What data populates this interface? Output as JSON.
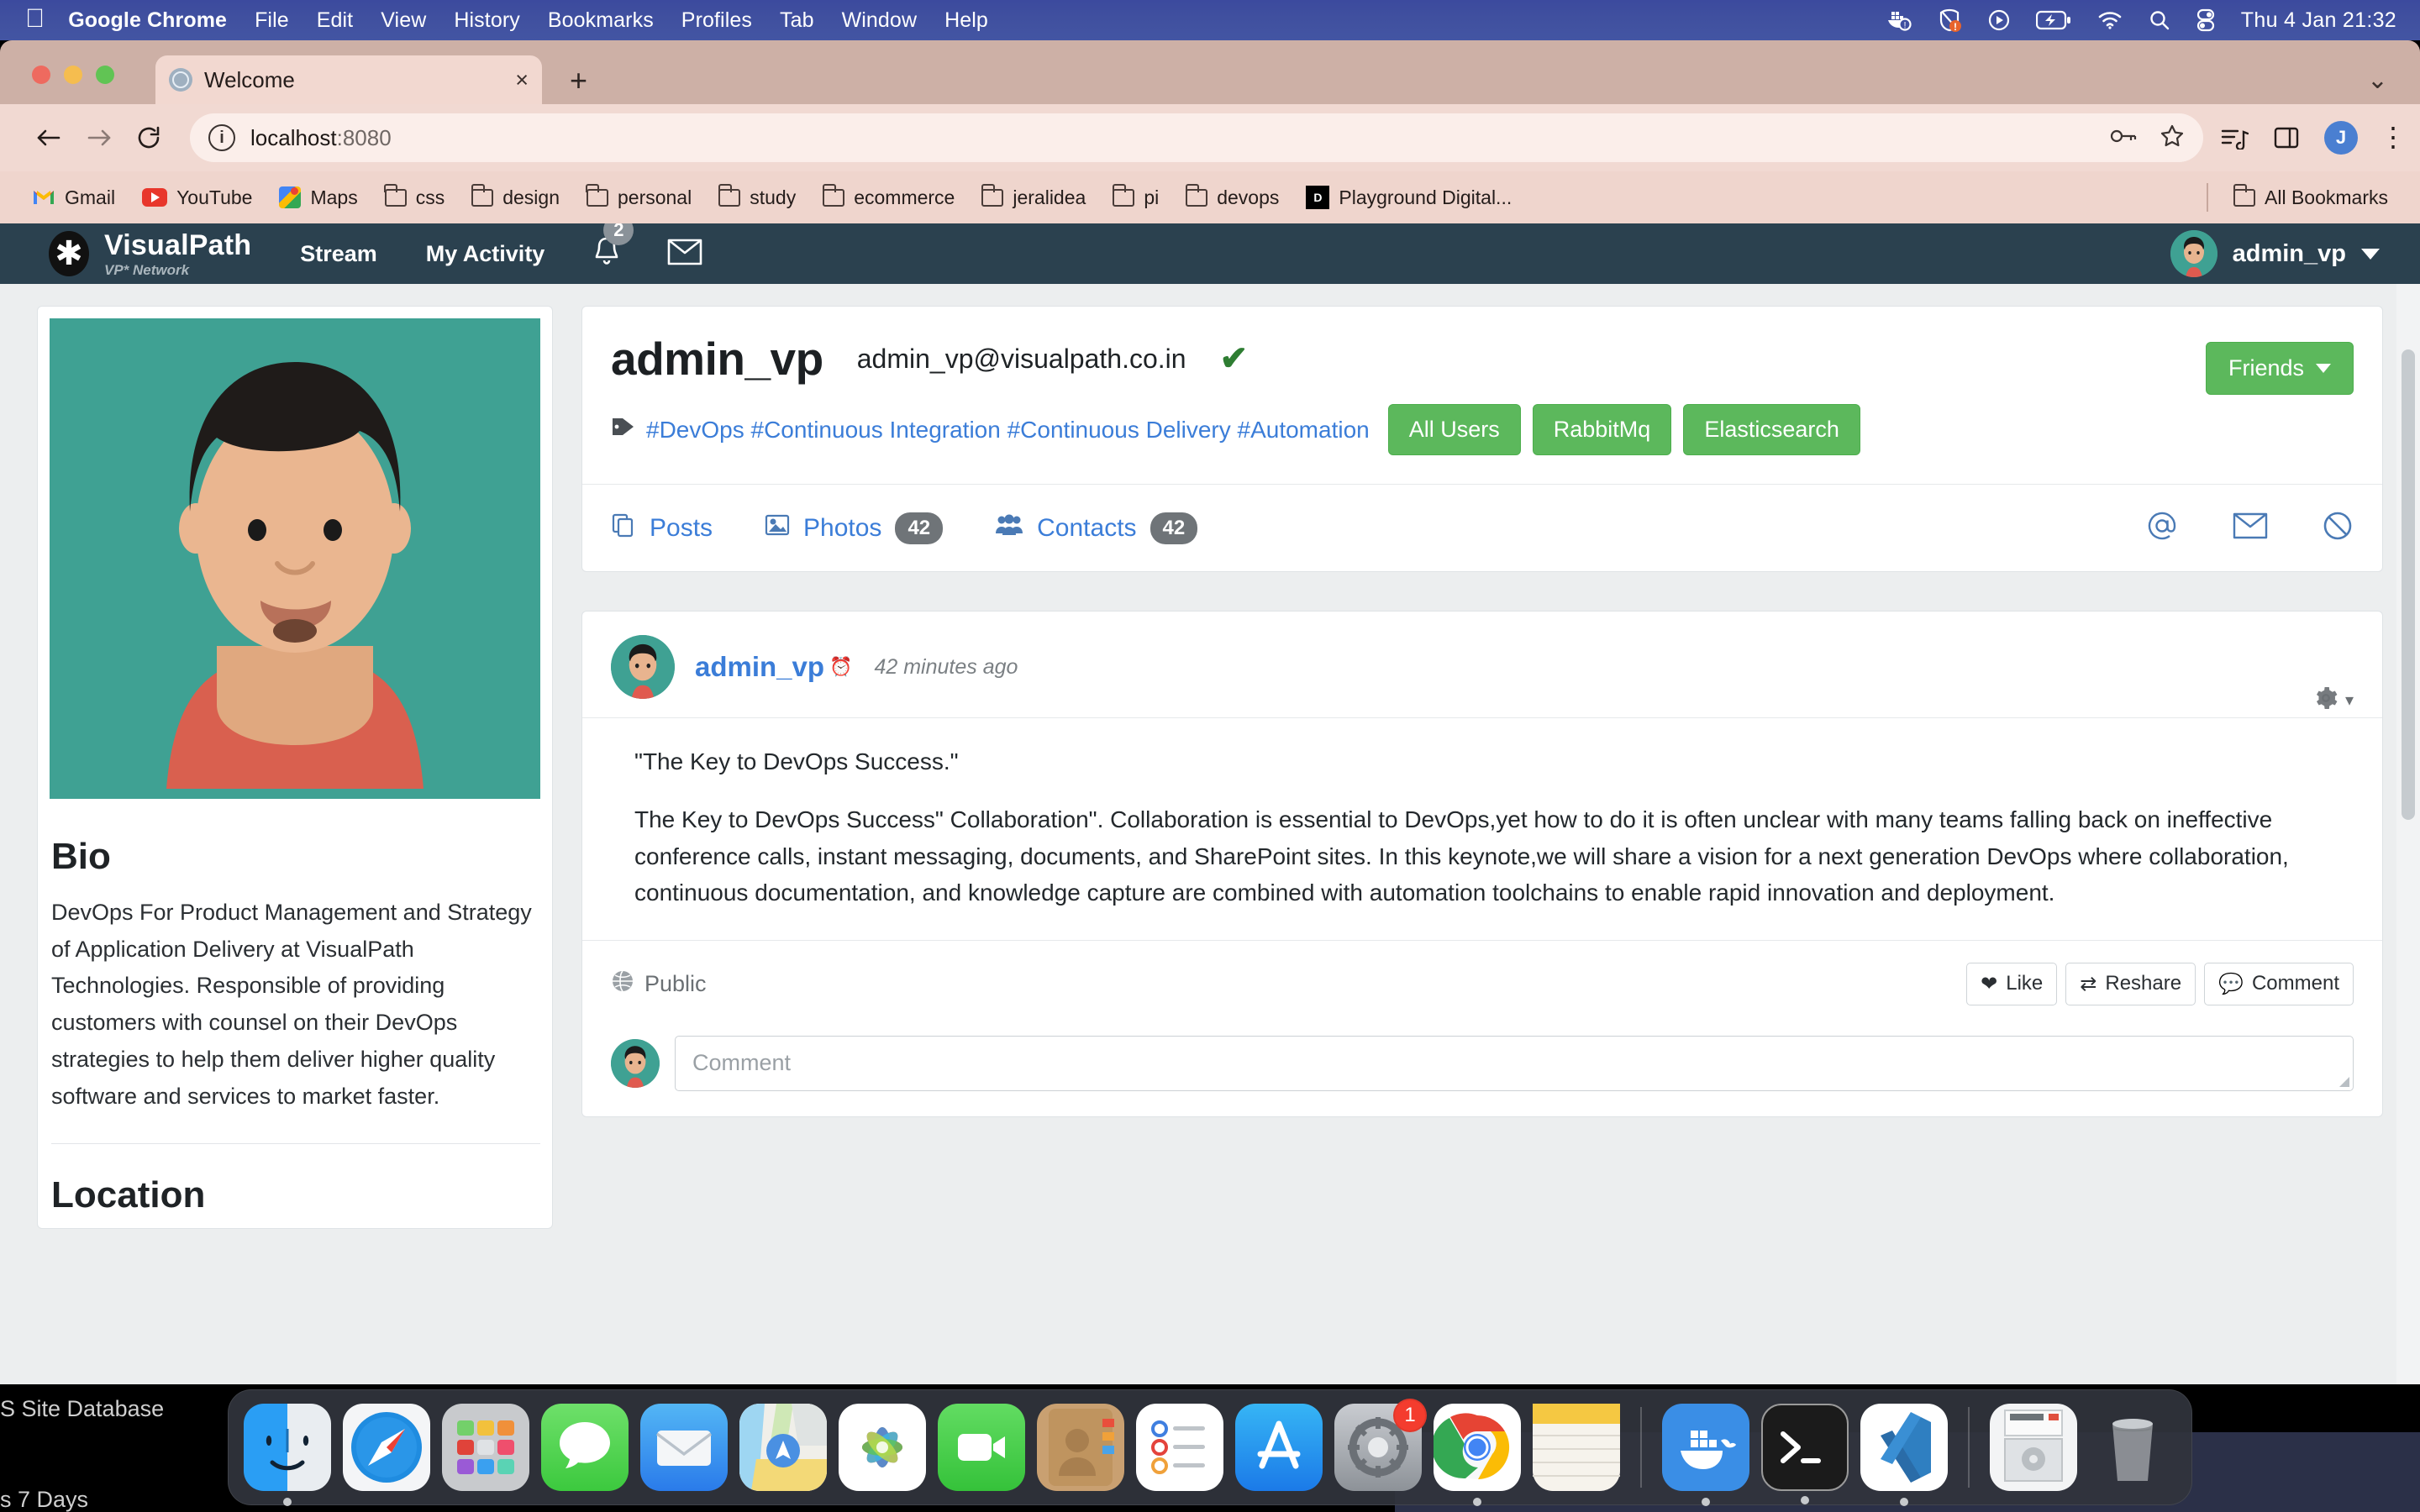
{
  "menubar": {
    "apple_icon": "apple-icon",
    "items": [
      {
        "label": "Google Chrome",
        "bold": true
      },
      {
        "label": "File",
        "bold": false
      },
      {
        "label": "Edit",
        "bold": false
      },
      {
        "label": "View",
        "bold": false
      },
      {
        "label": "History",
        "bold": false
      },
      {
        "label": "Bookmarks",
        "bold": false
      },
      {
        "label": "Profiles",
        "bold": false
      },
      {
        "label": "Tab",
        "bold": false
      },
      {
        "label": "Window",
        "bold": false
      },
      {
        "label": "Help",
        "bold": false
      }
    ],
    "status_icons": [
      "docker-icon",
      "security-warning-icon",
      "play-circle-icon",
      "battery-charging-icon",
      "wifi-icon",
      "search-icon",
      "control-center-icon"
    ],
    "clock": "Thu 4 Jan  21:32"
  },
  "browser": {
    "tab": {
      "title": "Welcome",
      "favicon": "globe-icon",
      "close": "×"
    },
    "new_tab_label": "+",
    "toolbar": {
      "back": "←",
      "forward": "→",
      "reload": "⟳",
      "site_info_icon": "info-icon",
      "url_host": "localhost",
      "url_port": ":8080",
      "password_icon": "password-key-icon",
      "bookmark_icon": "star-icon",
      "reading_list_icon": "reading-list-icon",
      "side_panel_icon": "side-panel-icon",
      "profile_initial": "J",
      "menu_icon": "kebab-menu-icon"
    },
    "bookmarks": [
      {
        "label": "Gmail",
        "icon": "gmail-icon"
      },
      {
        "label": "YouTube",
        "icon": "youtube-icon"
      },
      {
        "label": "Maps",
        "icon": "maps-icon"
      },
      {
        "label": "css",
        "icon": "folder-icon"
      },
      {
        "label": "design",
        "icon": "folder-icon"
      },
      {
        "label": "personal",
        "icon": "folder-icon"
      },
      {
        "label": "study",
        "icon": "folder-icon"
      },
      {
        "label": "ecommerce",
        "icon": "folder-icon"
      },
      {
        "label": "jeralidea",
        "icon": "folder-icon"
      },
      {
        "label": "pi",
        "icon": "folder-icon"
      },
      {
        "label": "devops",
        "icon": "folder-icon"
      },
      {
        "label": "Playground Digital...",
        "icon": "playground-digital-icon"
      }
    ],
    "all_bookmarks": {
      "label": "All Bookmarks",
      "icon": "folder-icon"
    }
  },
  "site": {
    "nav": {
      "brand": "VisualPath",
      "brand_sub": "VP* Network",
      "brand_mark": "asterisk-icon",
      "links": [
        "Stream",
        "My Activity"
      ],
      "bell_icon": "bell-icon",
      "bell_badge": "2",
      "mail_icon": "envelope-icon",
      "user": "admin_vp",
      "user_avatar": "avatar-icon",
      "user_caret": "chevron-down-icon"
    },
    "profile": {
      "name": "admin_vp",
      "email": "admin_vp@visualpath.co.in",
      "verified_icon": "check-icon",
      "friends_button": "Friends",
      "tag_icon": "tag-icon",
      "tags": "#DevOps #Continuous Integration #Continuous Delivery #Automation",
      "pills": [
        "All Users",
        "RabbitMq",
        "Elasticsearch"
      ],
      "tabs": [
        {
          "label": "Posts",
          "count": "",
          "icon": "posts-icon"
        },
        {
          "label": "Photos",
          "count": "42",
          "icon": "photo-icon"
        },
        {
          "label": "Contacts",
          "count": "42",
          "icon": "contacts-icon"
        }
      ],
      "tab_right_icons": [
        "at-icon",
        "envelope-icon",
        "block-icon"
      ]
    },
    "sidebar": {
      "bio_heading": "Bio",
      "bio_text": "DevOps For Product Management and Strategy of Application Delivery at VisualPath Technologies. Responsible of providing customers with counsel on their DevOps strategies to help them deliver higher quality software and services to market faster.",
      "location_heading": "Location"
    },
    "post": {
      "author": "admin_vp",
      "clock_icon": "clock-icon",
      "time": "42 minutes ago",
      "settings_icon": "gear-icon",
      "settings_caret": "chevron-down-icon",
      "title_line": "\"The Key to DevOps Success.\"",
      "body": "The Key to DevOps Success\" Collaboration\". Collaboration is essential to DevOps,yet how to do it is often unclear with many teams falling back on ineffective conference calls, instant messaging, documents, and SharePoint sites. In this keynote,we will share a vision for a next generation DevOps where collaboration, continuous documentation, and knowledge capture are combined with automation toolchains to enable rapid innovation and deployment.",
      "visibility": "Public",
      "visibility_icon": "globe-icon",
      "actions": [
        {
          "label": "Like",
          "icon": "heart-icon"
        },
        {
          "label": "Reshare",
          "icon": "retweet-icon"
        },
        {
          "label": "Comment",
          "icon": "comment-icon"
        }
      ],
      "comment_placeholder": "Comment",
      "comment_avatar": "avatar-icon"
    }
  },
  "desktop": {
    "background_text_1": "S Site Database",
    "background_text_2": "s 7 Days"
  },
  "dock": {
    "items": [
      {
        "name": "finder-icon",
        "running": true,
        "badge": ""
      },
      {
        "name": "safari-icon",
        "running": false,
        "badge": ""
      },
      {
        "name": "launchpad-icon",
        "running": false,
        "badge": ""
      },
      {
        "name": "messages-icon",
        "running": false,
        "badge": ""
      },
      {
        "name": "mail-icon",
        "running": false,
        "badge": ""
      },
      {
        "name": "maps-icon",
        "running": false,
        "badge": ""
      },
      {
        "name": "photos-icon",
        "running": false,
        "badge": ""
      },
      {
        "name": "facetime-icon",
        "running": false,
        "badge": ""
      },
      {
        "name": "contacts-icon",
        "running": false,
        "badge": ""
      },
      {
        "name": "reminders-icon",
        "running": false,
        "badge": ""
      },
      {
        "name": "app-store-icon",
        "running": false,
        "badge": ""
      },
      {
        "name": "system-settings-icon",
        "running": false,
        "badge": "1"
      },
      {
        "name": "chrome-icon",
        "running": true,
        "badge": ""
      },
      {
        "name": "notes-icon",
        "running": false,
        "badge": ""
      },
      {
        "name": "docker-icon",
        "running": true,
        "badge": ""
      },
      {
        "name": "terminal-icon",
        "running": true,
        "badge": ""
      },
      {
        "name": "vscode-icon",
        "running": true,
        "badge": ""
      },
      {
        "name": "downloads-stack-icon",
        "running": false,
        "badge": ""
      },
      {
        "name": "trash-icon",
        "running": false,
        "badge": ""
      }
    ]
  },
  "colors": {
    "menubar_blue": "#3f4fa0",
    "chrome_chrome": "#cdb0a6",
    "site_nav_dark": "#2b414f",
    "brand_green": "#5cb85c",
    "link_blue": "#3b7dd8",
    "avatar_teal": "#3fa193"
  }
}
